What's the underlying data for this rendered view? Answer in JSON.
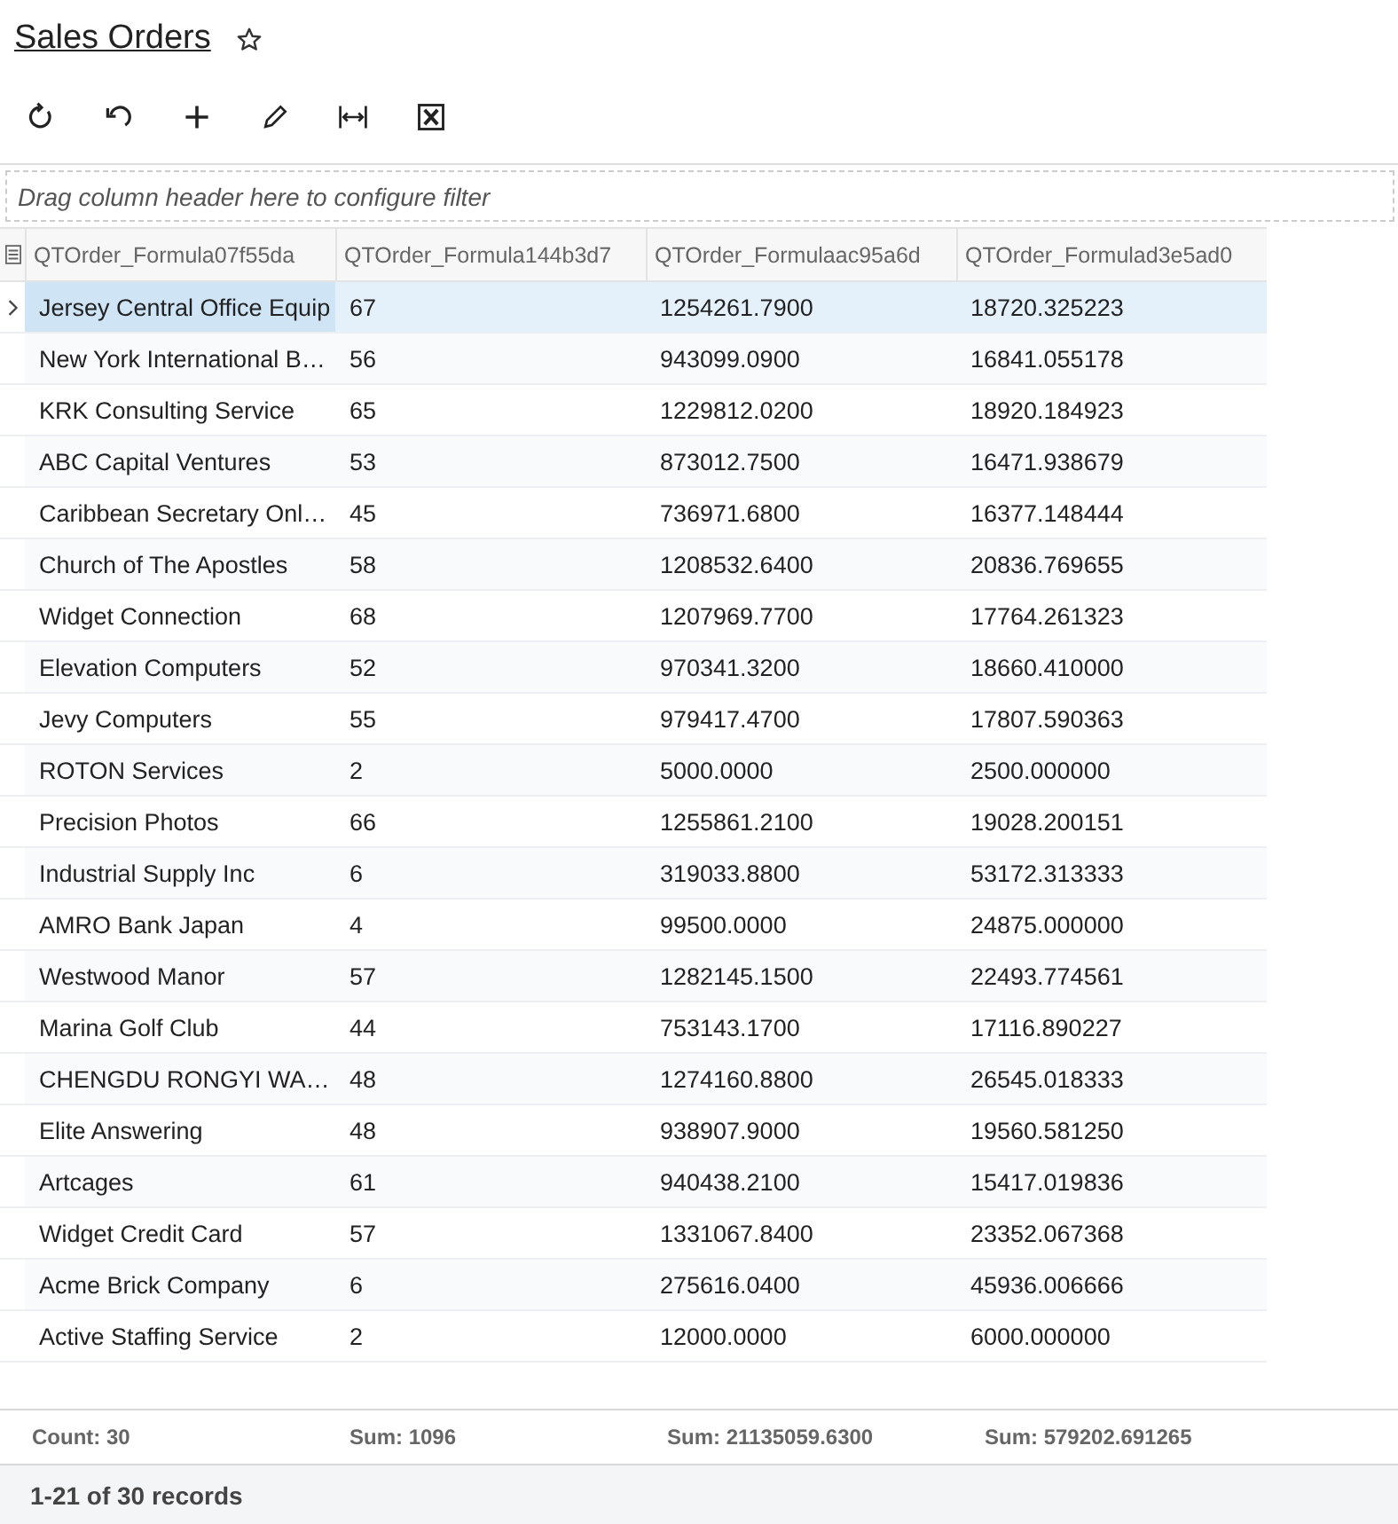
{
  "title": "Sales Orders",
  "favorite": false,
  "toolbar": [
    {
      "kind": "refresh"
    },
    {
      "kind": "undo"
    },
    {
      "kind": "add"
    },
    {
      "kind": "edit"
    },
    {
      "kind": "fit"
    },
    {
      "kind": "excel"
    }
  ],
  "filter_placeholder": "Drag column header here to configure filter",
  "columns": [
    "QTOrder_Formula07f55da",
    "QTOrder_Formula144b3d7",
    "QTOrder_Formulaac95a6d",
    "QTOrder_Formulad3e5ad0"
  ],
  "rows": [
    {
      "selected": true,
      "cells": [
        "Jersey Central Office Equip",
        "67",
        "1254261.7900",
        "18720.325223"
      ]
    },
    {
      "selected": false,
      "cells": [
        "New York International B…",
        "56",
        "943099.0900",
        "16841.055178"
      ]
    },
    {
      "selected": false,
      "cells": [
        "KRK Consulting Service",
        "65",
        "1229812.0200",
        "18920.184923"
      ]
    },
    {
      "selected": false,
      "cells": [
        "ABC Capital Ventures",
        "53",
        "873012.7500",
        "16471.938679"
      ]
    },
    {
      "selected": false,
      "cells": [
        "Caribbean Secretary Onl…",
        "45",
        "736971.6800",
        "16377.148444"
      ]
    },
    {
      "selected": false,
      "cells": [
        "Church of The Apostles",
        "58",
        "1208532.6400",
        "20836.769655"
      ]
    },
    {
      "selected": false,
      "cells": [
        "Widget Connection",
        "68",
        "1207969.7700",
        "17764.261323"
      ]
    },
    {
      "selected": false,
      "cells": [
        "Elevation Computers",
        "52",
        "970341.3200",
        "18660.410000"
      ]
    },
    {
      "selected": false,
      "cells": [
        "Jevy Computers",
        "55",
        "979417.4700",
        "17807.590363"
      ]
    },
    {
      "selected": false,
      "cells": [
        "ROTON Services",
        "2",
        "5000.0000",
        "2500.000000"
      ]
    },
    {
      "selected": false,
      "cells": [
        "Precision Photos",
        "66",
        "1255861.2100",
        "19028.200151"
      ]
    },
    {
      "selected": false,
      "cells": [
        "Industrial Supply Inc",
        "6",
        "319033.8800",
        "53172.313333"
      ]
    },
    {
      "selected": false,
      "cells": [
        "AMRO Bank Japan",
        "4",
        "99500.0000",
        "24875.000000"
      ]
    },
    {
      "selected": false,
      "cells": [
        "Westwood Manor",
        "57",
        "1282145.1500",
        "22493.774561"
      ]
    },
    {
      "selected": false,
      "cells": [
        "Marina Golf Club",
        "44",
        "753143.1700",
        "17116.890227"
      ]
    },
    {
      "selected": false,
      "cells": [
        "CHENGDU RONGYI WA…",
        "48",
        "1274160.8800",
        "26545.018333"
      ]
    },
    {
      "selected": false,
      "cells": [
        "Elite Answering",
        "48",
        "938907.9000",
        "19560.581250"
      ]
    },
    {
      "selected": false,
      "cells": [
        "Artcages",
        "61",
        "940438.2100",
        "15417.019836"
      ]
    },
    {
      "selected": false,
      "cells": [
        "Widget Credit Card",
        "57",
        "1331067.8400",
        "23352.067368"
      ]
    },
    {
      "selected": false,
      "cells": [
        "Acme Brick Company",
        "6",
        "275616.0400",
        "45936.006666"
      ]
    },
    {
      "selected": false,
      "cells": [
        "Active Staffing Service",
        "2",
        "12000.0000",
        "6000.000000"
      ]
    }
  ],
  "summary": [
    "Count: 30",
    "Sum: 1096",
    "Sum: 21135059.6300",
    "Sum: 579202.691265"
  ],
  "records": "1-21 of 30 records"
}
